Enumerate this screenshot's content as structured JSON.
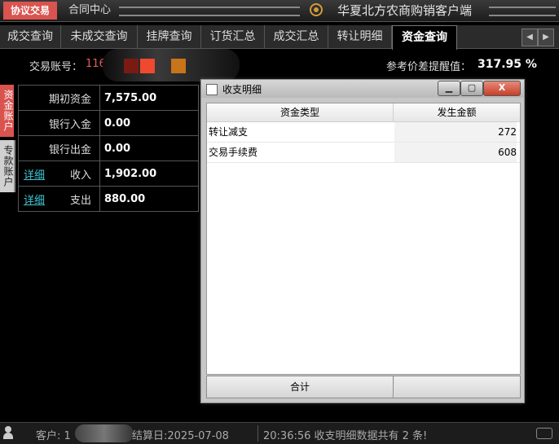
{
  "topbar": {
    "tab_active": "协议交易",
    "tab_contract": "合同中心",
    "app_title": "华夏北方农商购销客户端"
  },
  "tabs": [
    {
      "label": "成交查询"
    },
    {
      "label": "未成交查询"
    },
    {
      "label": "挂牌查询"
    },
    {
      "label": "订货汇总"
    },
    {
      "label": "成交汇总"
    },
    {
      "label": "转让明细"
    },
    {
      "label": "资金查询"
    }
  ],
  "account": {
    "label": "交易账号：",
    "value": "116",
    "ref_label": "参考价差提醒值：",
    "ref_value": "317.95 %"
  },
  "side_tabs": {
    "fund_account": "资金账户",
    "special_account": "专款账户"
  },
  "summary": {
    "rows": [
      {
        "label": "期初资金",
        "value": "7,575.00"
      },
      {
        "label": "银行入金",
        "value": "0.00"
      },
      {
        "label": "银行出金",
        "value": "0.00"
      },
      {
        "link": "详细",
        "label": "收入",
        "value": "1,902.00"
      },
      {
        "link": "详细",
        "label": "支出",
        "value": "880.00"
      }
    ]
  },
  "dialog": {
    "title": "收支明细",
    "columns": [
      "资金类型",
      "发生金额"
    ],
    "rows": [
      {
        "type": "转让减支",
        "amount": "272"
      },
      {
        "type": "交易手续费",
        "amount": "608"
      }
    ],
    "footer_total_label": "合计",
    "min_icon": "minimize-icon",
    "max_icon": "maximize-icon",
    "close_icon": "close-icon",
    "min_glyph": "▁",
    "max_glyph": "▢",
    "close_glyph": "X"
  },
  "arrows": {
    "left": "◀",
    "right": "▶"
  },
  "status": {
    "customer": "客户: 1",
    "settle_date": "结算日:2025-07-08",
    "message": "20:36:56 收支明细数据共有 2 条!"
  },
  "colors": {
    "accent_red": "#d9534f",
    "link_cyan": "#3fc6d6",
    "account_red": "#e25c5c",
    "redact_dark_red": "#7a1a14",
    "redact_red": "#ef4a2f",
    "redact_orange": "#c8741a"
  }
}
